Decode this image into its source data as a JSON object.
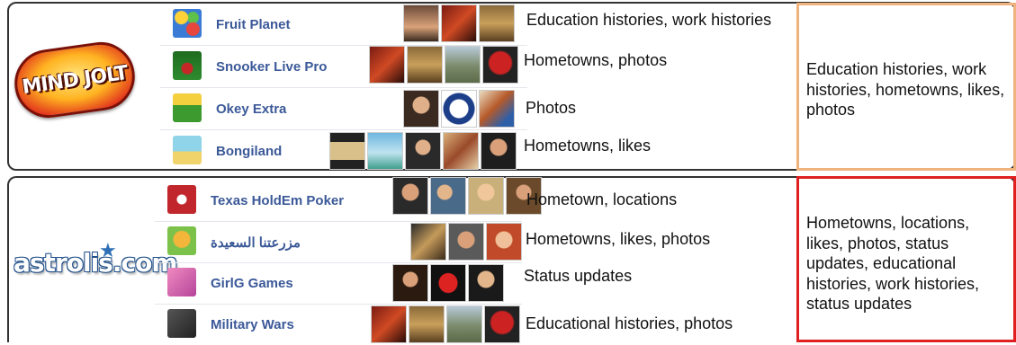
{
  "groups": [
    {
      "logo": "MIND JOLT",
      "apps": [
        {
          "name": "Fruit Planet",
          "info": "Education histories, work histories",
          "icon_color": "#3a7bd5"
        },
        {
          "name": "Snooker Live Pro",
          "info": "Hometowns, photos",
          "icon_color": "#2e8b2e"
        },
        {
          "name": "Okey Extra",
          "info": "Photos",
          "icon_color": "#3c9a2f"
        },
        {
          "name": "Bongiland",
          "info": "Hometowns, likes",
          "icon_color": "#8fd4e8"
        }
      ],
      "summary": "Education histories, work histories, hometowns, likes, photos",
      "summary_color": "#f1b37d"
    },
    {
      "logo": "astrolis.com",
      "apps": [
        {
          "name": "Texas HoldEm Poker",
          "info": "Hometown, locations",
          "icon_color": "#c0262c"
        },
        {
          "name": "مزرعتنا السعيدة",
          "info": "Hometowns, likes, photos",
          "icon_color": "#e8a23a"
        },
        {
          "name": "GirlG Games",
          "info": "Status updates",
          "icon_color": "#d65fa8"
        },
        {
          "name": "Military Wars",
          "info": "Educational histories, photos",
          "icon_color": "#3b3b3b"
        }
      ],
      "summary": "Hometowns, locations, likes, photos, status updates, educational histories, work histories, status updates",
      "summary_color": "#e02020"
    }
  ]
}
